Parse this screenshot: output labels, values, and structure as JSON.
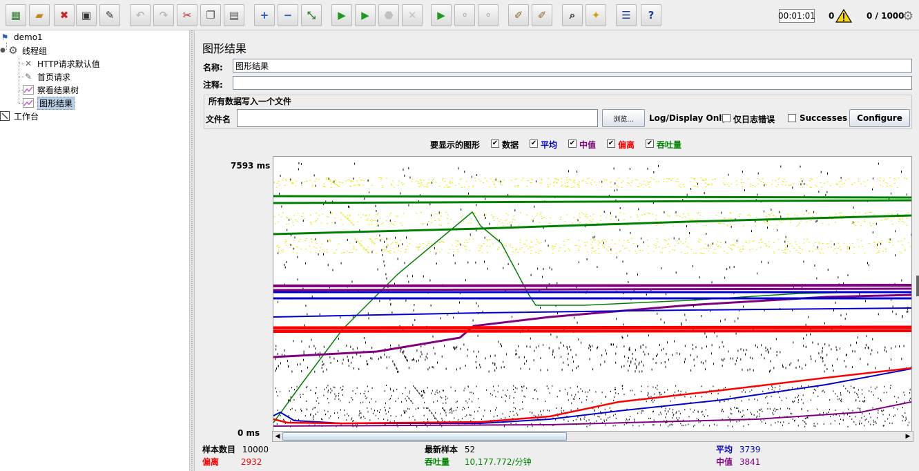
{
  "toolbar": {
    "buttons": [
      {
        "icon": "templates-icon",
        "glyph": "▦",
        "color": "#2a7a2a",
        "enabled": true
      },
      {
        "icon": "open-icon",
        "glyph": "▰",
        "color": "#c08a20",
        "enabled": true
      },
      {
        "icon": "close-file-icon",
        "glyph": "✖",
        "color": "#cc2222",
        "enabled": true
      },
      {
        "icon": "save-icon",
        "glyph": "▣",
        "color": "#333333",
        "enabled": true
      },
      {
        "icon": "save-as-icon",
        "glyph": "✎",
        "color": "#333333",
        "enabled": true
      },
      {
        "icon": "undo-icon",
        "glyph": "↶",
        "color": "#bbbbbb",
        "enabled": false
      },
      {
        "icon": "redo-icon",
        "glyph": "↷",
        "color": "#bbbbbb",
        "enabled": false
      },
      {
        "icon": "cut-icon",
        "glyph": "✂",
        "color": "#cc2222",
        "enabled": true
      },
      {
        "icon": "copy-icon",
        "glyph": "❐",
        "color": "#555555",
        "enabled": true
      },
      {
        "icon": "paste-icon",
        "glyph": "▤",
        "color": "#555555",
        "enabled": true
      },
      {
        "icon": "expand-icon",
        "glyph": "+",
        "color": "#1f5fbf",
        "enabled": true
      },
      {
        "icon": "collapse-icon",
        "glyph": "−",
        "color": "#1f5fbf",
        "enabled": true
      },
      {
        "icon": "toggle-icon",
        "glyph": "⤡",
        "color": "#2a7a2a",
        "enabled": true
      },
      {
        "icon": "start-icon",
        "glyph": "▶",
        "color": "#1e9a1e",
        "enabled": true
      },
      {
        "icon": "start-no-pause-icon",
        "glyph": "▶",
        "color": "#1e9a1e",
        "enabled": true
      },
      {
        "icon": "stop-icon",
        "glyph": "⬣",
        "color": "#c0c0c0",
        "enabled": false
      },
      {
        "icon": "shutdown-icon",
        "glyph": "✕",
        "color": "#c0c0c0",
        "enabled": false
      },
      {
        "icon": "remote-start-icon",
        "glyph": "▶",
        "color": "#1e9a1e",
        "enabled": true
      },
      {
        "icon": "remote-stop-icon",
        "glyph": "⚬",
        "color": "#aaaaaa",
        "enabled": true
      },
      {
        "icon": "remote-shutdown-icon",
        "glyph": "⚬",
        "color": "#aaaaaa",
        "enabled": true
      },
      {
        "icon": "clear-icon",
        "glyph": "✐",
        "color": "#8a6a2a",
        "enabled": true
      },
      {
        "icon": "clear-all-icon",
        "glyph": "✐",
        "color": "#8a6a2a",
        "enabled": true
      },
      {
        "icon": "search-icon",
        "glyph": "⌕",
        "color": "#222222",
        "enabled": true
      },
      {
        "icon": "reset-search-icon",
        "glyph": "✦",
        "color": "#d4a000",
        "enabled": true
      },
      {
        "icon": "function-helper-icon",
        "glyph": "☰",
        "color": "#1f3f8f",
        "enabled": true
      },
      {
        "icon": "help-icon",
        "glyph": "?",
        "color": "#1f3f8f",
        "enabled": true
      }
    ],
    "elapsed_time": "00:01:01",
    "error_count": "0",
    "threads": "0 / 1000"
  },
  "tree": {
    "items": [
      {
        "label": "demo1",
        "icon": "test-plan-icon",
        "level": 0
      },
      {
        "label": "线程组",
        "icon": "thread-group-icon",
        "level": 1
      },
      {
        "label": "HTTP请求默认值",
        "icon": "config-element-icon",
        "level": 2
      },
      {
        "label": "首页请求",
        "icon": "sampler-icon",
        "level": 2
      },
      {
        "label": "察看结果树",
        "icon": "listener-icon",
        "level": 2
      },
      {
        "label": "图形结果",
        "icon": "listener-icon",
        "level": 2,
        "selected": true
      },
      {
        "label": "工作台",
        "icon": "workbench-icon",
        "level": 0
      }
    ]
  },
  "panel": {
    "title": "图形结果",
    "name_label": "名称:",
    "name_value": "图形结果",
    "comment_label": "注释:",
    "comment_value": "",
    "file_section_title": "所有数据写入一个文件",
    "filename_label": "文件名",
    "filename_value": "",
    "browse_label": "浏览...",
    "log_display_label": "Log/Display Only:",
    "errors_only_label": "仅日志错误",
    "successes_label": "Successes",
    "configure_label": "Configure"
  },
  "graph_options": {
    "label": "要显示的图形",
    "items": [
      {
        "label": "数据",
        "checked": true,
        "color": "#000000"
      },
      {
        "label": "平均",
        "checked": true,
        "color": "#0000cc"
      },
      {
        "label": "中值",
        "checked": true,
        "color": "#800080"
      },
      {
        "label": "偏离",
        "checked": true,
        "color": "#ff0000"
      },
      {
        "label": "吞吐量",
        "checked": true,
        "color": "#008000"
      }
    ]
  },
  "chart_data": {
    "type": "scatter",
    "y_max_label": "7593 ms",
    "y_min_label": "0 ms",
    "ylim": [
      0,
      7593
    ],
    "series": [
      {
        "name": "数据",
        "color": "#000000"
      },
      {
        "name": "平均",
        "color": "#0000cc"
      },
      {
        "name": "中值",
        "color": "#800080"
      },
      {
        "name": "偏离",
        "color": "#ff0000"
      },
      {
        "name": "吞吐量",
        "color": "#008000"
      }
    ]
  },
  "stats": {
    "sample_count_label": "样本数目",
    "sample_count": "10000",
    "latest_sample_label": "最新样本",
    "latest_sample": "52",
    "average_label": "平均",
    "average": "3739",
    "deviation_label": "偏离",
    "deviation": "2932",
    "throughput_label": "吞吐量",
    "throughput": "10,177.772/分钟",
    "median_label": "中值",
    "median": "3841"
  },
  "colors": {
    "average": "#0000cc",
    "median": "#800080",
    "deviation": "#ff0000",
    "throughput": "#008000",
    "data": "#000000",
    "yellow_data": "#e8e800"
  }
}
